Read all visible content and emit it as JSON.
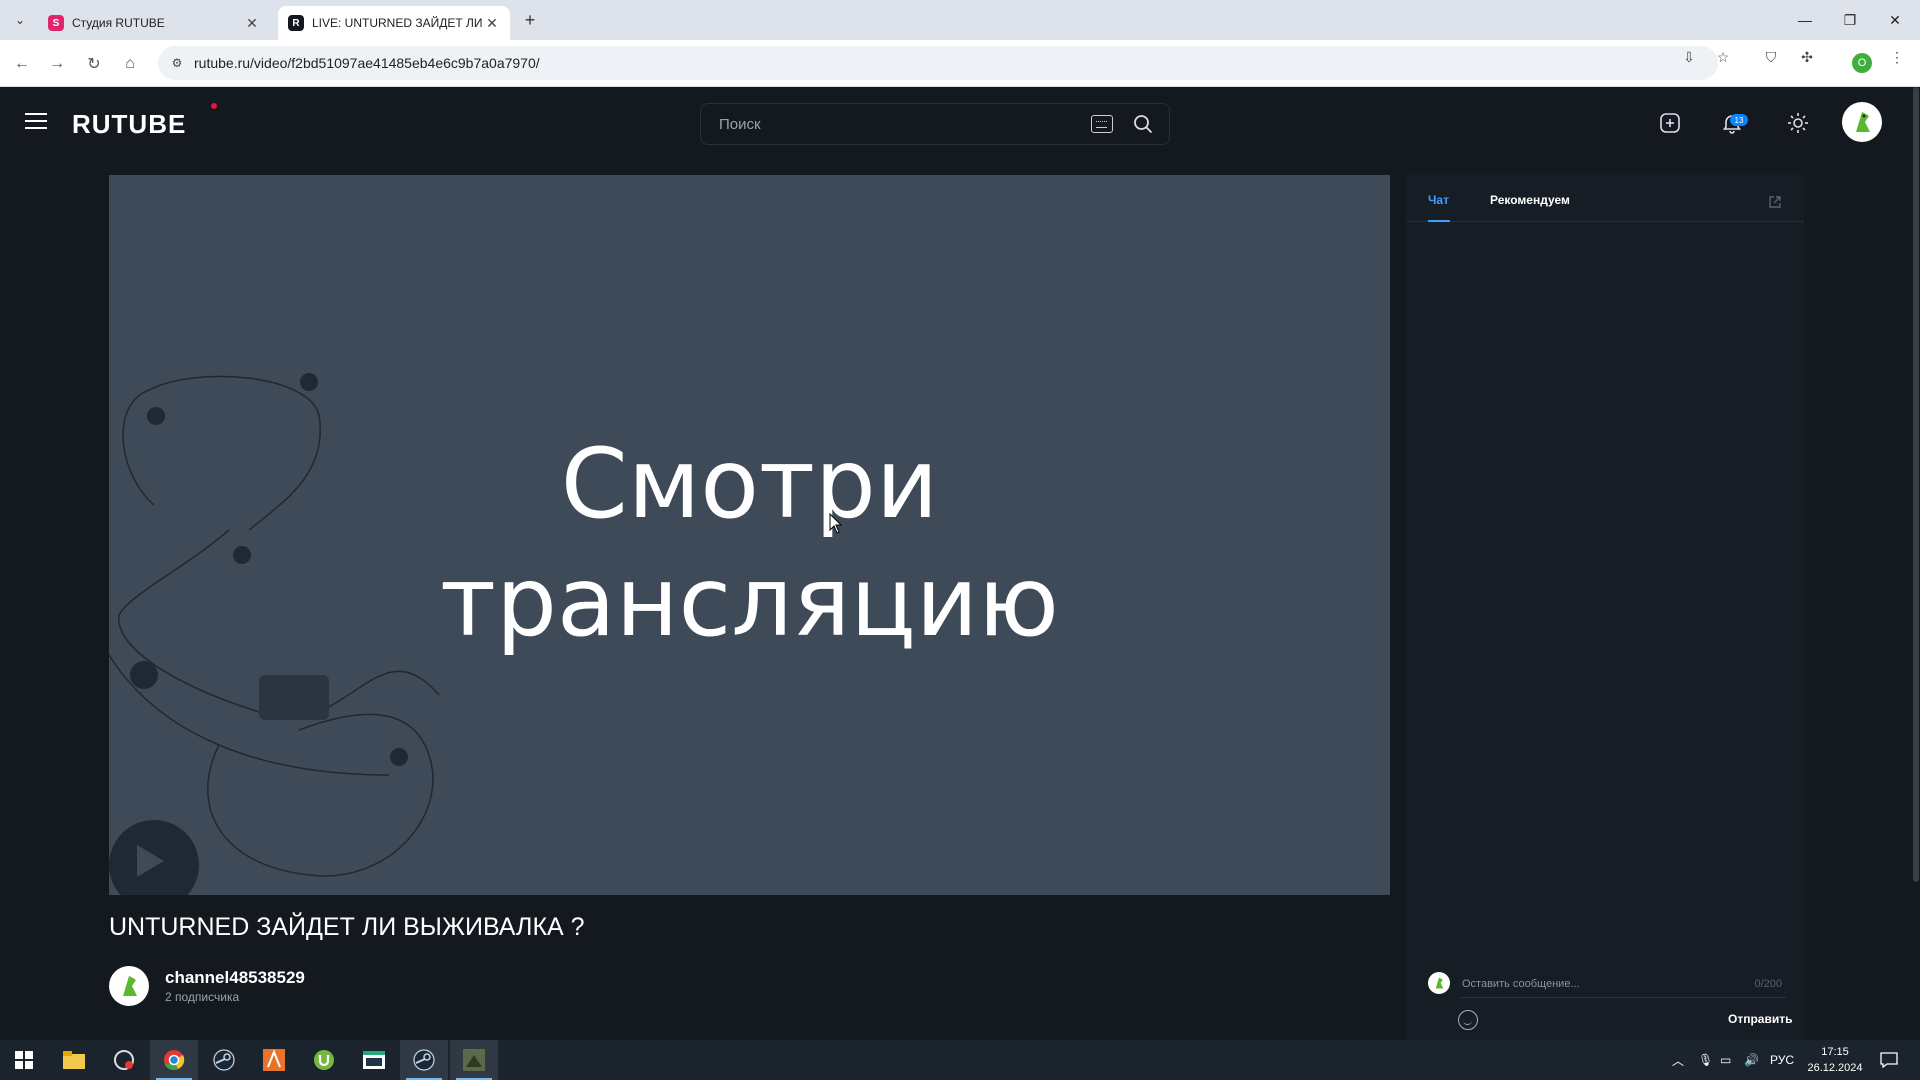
{
  "browser": {
    "tabs": [
      {
        "title": "Студия RUTUBE",
        "active": false
      },
      {
        "title": "LIVE: UNTURNED ЗАЙДЕТ ЛИ В",
        "active": true
      }
    ],
    "url": "rutube.ru/video/f2bd51097ae41485eb4e6c9b7a0a7970/",
    "profile_letter": "O"
  },
  "header": {
    "logo": "RUTUBE",
    "search_placeholder": "Поиск",
    "notification_count": "13"
  },
  "video": {
    "overlay_line1": "Смотри",
    "overlay_line2": "трансляцию",
    "title": "UNTURNED ЗАЙДЕТ ЛИ ВЫЖИВАЛКА ?",
    "background_color": "#3e4a57"
  },
  "channel": {
    "name": "channel48538529",
    "subscribers": "2 подписчика"
  },
  "side_panel": {
    "tabs": [
      "Чат",
      "Рекомендуем"
    ],
    "active_tab": "Чат",
    "chat_placeholder": "Оставить сообщение...",
    "char_count": "0/200",
    "send_label": "Отправить"
  },
  "taskbar": {
    "language": "РУС",
    "time": "17:15",
    "date": "26.12.2024"
  },
  "colors": {
    "accent": "#3aa0ff",
    "brand_red": "#ed143b",
    "page_bg": "#14191f"
  }
}
